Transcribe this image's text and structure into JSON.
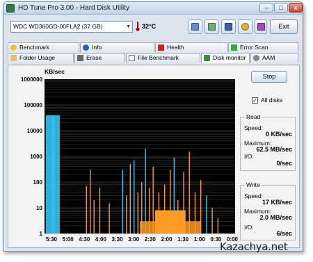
{
  "window": {
    "title": "HD Tune Pro 3.00 - Hard Disk Utility",
    "min_label": "–",
    "max_label": "□",
    "close_label": "x"
  },
  "toolbar": {
    "drive": "WDC WD360GD-00FLA2 (37 GB)",
    "temperature": "32°C",
    "exit_label": "Exit",
    "buttons": [
      "copy-info-icon",
      "copy-screen-icon",
      "save-icon",
      "options-icon",
      "download-icon"
    ]
  },
  "tabs_top": [
    "Benchmark",
    "Info",
    "Health",
    "Error Scan"
  ],
  "tabs_bottom": [
    "Folder Usage",
    "Erase",
    "File Benchmark",
    "Disk monitor",
    "AAM"
  ],
  "active_tab": "Disk monitor",
  "monitor": {
    "stop_label": "Stop",
    "all_disks_label": "All disks",
    "all_disks_checked": true,
    "read": {
      "title": "Read",
      "speed_label": "Speed:",
      "speed": "0 KB/sec",
      "max_label": "Maximum:",
      "max": "62.5 MB/sec",
      "io_label": "I/O:",
      "io": "0/sec"
    },
    "write": {
      "title": "Write",
      "speed_label": "Speed:",
      "speed": "17 KB/sec",
      "max_label": "Maximum:",
      "max": "2.0 MB/sec",
      "io_label": "I/O:",
      "io": "6/sec"
    }
  },
  "chart_data": {
    "type": "bar",
    "ylabel": "KB/sec",
    "yscale": "log",
    "ylim": [
      1,
      1000000
    ],
    "yticks": [
      "1000000",
      "100000",
      "10000",
      "1000",
      "100",
      "10",
      "1"
    ],
    "xticks": [
      "5:30",
      "5:00",
      "4:30",
      "4:00",
      "3:30",
      "3:00",
      "2:30",
      "2:00",
      "1:30",
      "1:00",
      "0:30",
      "0:00"
    ],
    "background": "#000000",
    "grid": true,
    "series": [
      {
        "color": "#33c6f2",
        "values": [
          0,
          0,
          40000,
          40000,
          40000,
          40000,
          40000,
          40000,
          40000,
          40000,
          40000,
          40000,
          40000,
          40000,
          40000,
          40000,
          40000,
          40000,
          40000,
          40000,
          40000,
          0,
          0,
          0,
          0,
          0,
          0,
          0,
          0,
          0,
          0,
          0,
          0,
          0,
          0,
          0,
          0,
          0,
          0,
          0,
          0,
          0,
          0,
          0,
          0,
          0,
          0,
          0,
          0,
          0,
          0,
          0,
          0,
          0,
          0,
          0,
          0,
          0,
          0,
          0,
          0,
          0,
          0,
          0,
          0,
          0,
          0,
          0,
          0,
          0,
          0,
          0,
          0,
          0,
          0,
          0,
          0,
          0,
          0,
          0,
          0,
          0,
          0,
          0,
          0,
          0,
          0,
          0,
          0,
          0,
          0,
          0,
          0,
          0,
          0,
          0,
          0,
          0,
          0,
          0,
          0,
          0,
          0,
          0,
          0,
          0,
          0,
          0,
          0,
          0,
          0,
          0,
          0,
          0,
          0,
          0,
          0,
          0,
          0,
          0,
          0,
          0,
          0,
          0,
          0,
          0,
          0,
          0,
          0,
          0,
          0,
          0,
          0,
          0,
          0,
          0,
          0,
          0,
          0,
          0,
          0,
          0,
          0,
          0,
          0,
          0,
          0,
          0,
          0,
          0,
          0,
          0,
          0,
          0,
          0,
          0,
          0,
          0,
          0,
          0,
          0,
          0,
          0,
          0,
          0,
          0,
          0,
          0,
          0,
          0,
          0,
          0,
          0,
          0,
          0,
          0,
          0,
          0,
          0,
          0,
          0,
          0,
          0,
          0,
          0,
          0,
          0,
          0,
          0,
          0,
          0,
          0,
          0,
          0,
          0,
          0,
          0,
          0,
          0,
          0,
          0,
          0,
          0,
          0,
          0,
          0,
          0,
          0,
          0,
          0,
          0,
          0,
          0,
          0,
          0,
          0,
          0,
          0,
          0,
          0,
          0,
          0,
          0,
          0,
          0,
          0,
          0,
          0,
          0,
          0,
          0,
          0,
          0,
          0,
          0,
          0,
          0,
          0,
          0,
          0,
          0,
          0,
          0,
          0,
          0,
          0,
          0,
          0,
          0,
          0,
          0,
          0,
          0,
          0,
          0,
          0,
          0,
          0,
          0,
          0,
          0,
          0,
          0
        ]
      }
    ]
  }
}
